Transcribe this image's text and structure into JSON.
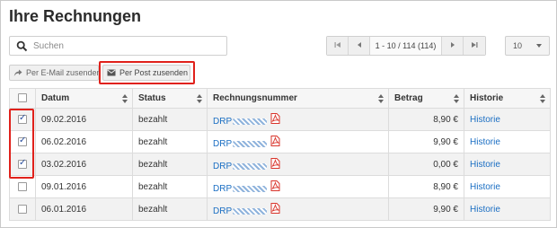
{
  "page": {
    "title": "Ihre Rechnungen"
  },
  "search": {
    "placeholder": "Suchen"
  },
  "pager": {
    "info": "1 - 10 / 114 (114)"
  },
  "page_size": {
    "value": "10"
  },
  "actions": {
    "email_label": "Per E-Mail zusenden",
    "post_label": "Per Post zusenden"
  },
  "table": {
    "columns": [
      "Datum",
      "Status",
      "Rechnungsnummer",
      "Betrag",
      "Historie"
    ],
    "rows": [
      {
        "checked": true,
        "datum": "09.02.2016",
        "status": "bezahlt",
        "nummer_prefix": "DRP",
        "betrag": "8,90 €",
        "historie": "Historie"
      },
      {
        "checked": true,
        "datum": "06.02.2016",
        "status": "bezahlt",
        "nummer_prefix": "DRP",
        "betrag": "9,90 €",
        "historie": "Historie"
      },
      {
        "checked": true,
        "datum": "03.02.2016",
        "status": "bezahlt",
        "nummer_prefix": "DRP",
        "betrag": "0,00 €",
        "historie": "Historie"
      },
      {
        "checked": false,
        "datum": "09.01.2016",
        "status": "bezahlt",
        "nummer_prefix": "DRP",
        "betrag": "8,90 €",
        "historie": "Historie"
      },
      {
        "checked": false,
        "datum": "06.01.2016",
        "status": "bezahlt",
        "nummer_prefix": "DRP",
        "betrag": "9,90 €",
        "historie": "Historie"
      }
    ]
  },
  "icons": {
    "search": "search-icon",
    "first_page": "first-page-icon",
    "prev_page": "prev-page-icon",
    "next_page": "next-page-icon",
    "last_page": "last-page-icon",
    "share": "share-arrow-icon",
    "envelope": "envelope-icon",
    "sort": "sort-icon",
    "pdf": "pdf-icon"
  },
  "colors": {
    "highlight": "#e0211b",
    "link": "#1a6ec3",
    "pdf": "#d9342b"
  }
}
